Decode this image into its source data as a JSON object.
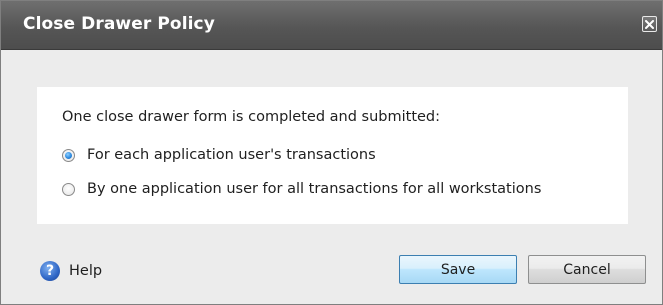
{
  "dialog": {
    "title": "Close Drawer Policy",
    "close_icon": "close-icon"
  },
  "form": {
    "prompt": "One close drawer form is completed and submitted:",
    "options": [
      {
        "label": "For each application user's transactions",
        "selected": true
      },
      {
        "label": "By one application user for all transactions for all workstations",
        "selected": false
      }
    ]
  },
  "footer": {
    "help_icon": "help-icon",
    "help_glyph": "?",
    "help_label": "Help",
    "save_label": "Save",
    "cancel_label": "Cancel"
  },
  "colors": {
    "titlebar": "#565656",
    "dialog_background": "#ececec",
    "panel_background": "#ffffff",
    "save_button_accent": "#bee6fd",
    "radio_selected": "#2f8be0",
    "help_icon": "#2f66c6"
  }
}
